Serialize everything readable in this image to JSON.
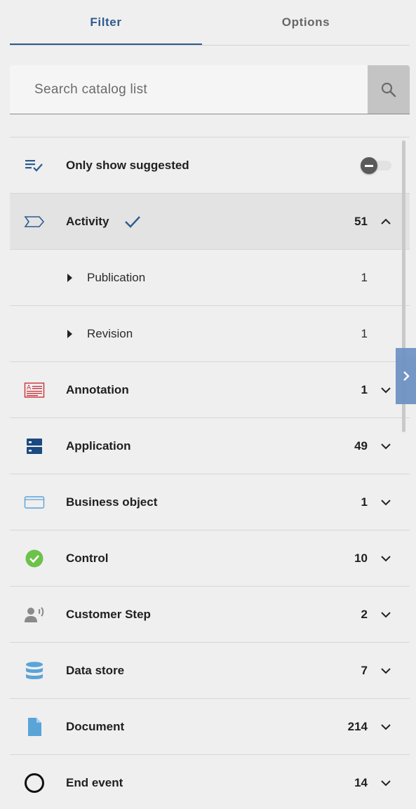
{
  "tabs": [
    {
      "label": "Filter",
      "active": true
    },
    {
      "label": "Options",
      "active": false
    }
  ],
  "search": {
    "placeholder": "Search catalog list",
    "value": "",
    "button_icon": "search-icon"
  },
  "suggested": {
    "label": "Only show suggested",
    "icon": "playlist-check-icon",
    "toggle_on": false
  },
  "items": [
    {
      "label": "Activity",
      "count": "51",
      "icon": "activity-tag-icon",
      "expanded": true,
      "selected": true,
      "children": [
        {
          "label": "Publication",
          "count": "1"
        },
        {
          "label": "Revision",
          "count": "1"
        }
      ]
    },
    {
      "label": "Annotation",
      "count": "1",
      "icon": "annotation-icon",
      "expanded": false
    },
    {
      "label": "Application",
      "count": "49",
      "icon": "application-server-icon",
      "expanded": false
    },
    {
      "label": "Business object",
      "count": "1",
      "icon": "business-object-icon",
      "expanded": false
    },
    {
      "label": "Control",
      "count": "10",
      "icon": "check-circle-icon",
      "expanded": false
    },
    {
      "label": "Customer Step",
      "count": "2",
      "icon": "customer-voice-icon",
      "expanded": false
    },
    {
      "label": "Data store",
      "count": "7",
      "icon": "database-icon",
      "expanded": false
    },
    {
      "label": "Document",
      "count": "214",
      "icon": "document-icon",
      "expanded": false
    },
    {
      "label": "End event",
      "count": "14",
      "icon": "end-event-circle-icon",
      "expanded": false
    }
  ],
  "colors": {
    "accent": "#2d5b8f",
    "highlight_row": "#e3e3e3",
    "side_handle": "#6f93c4",
    "annotation": "#c9323a",
    "application": "#1b4a82",
    "business_object": "#5aa4d8",
    "control": "#6cc24a",
    "customer_step": "#8a8a8a",
    "data_store": "#5aa4d8",
    "document": "#5aa4d8",
    "end_event": "#111111"
  }
}
